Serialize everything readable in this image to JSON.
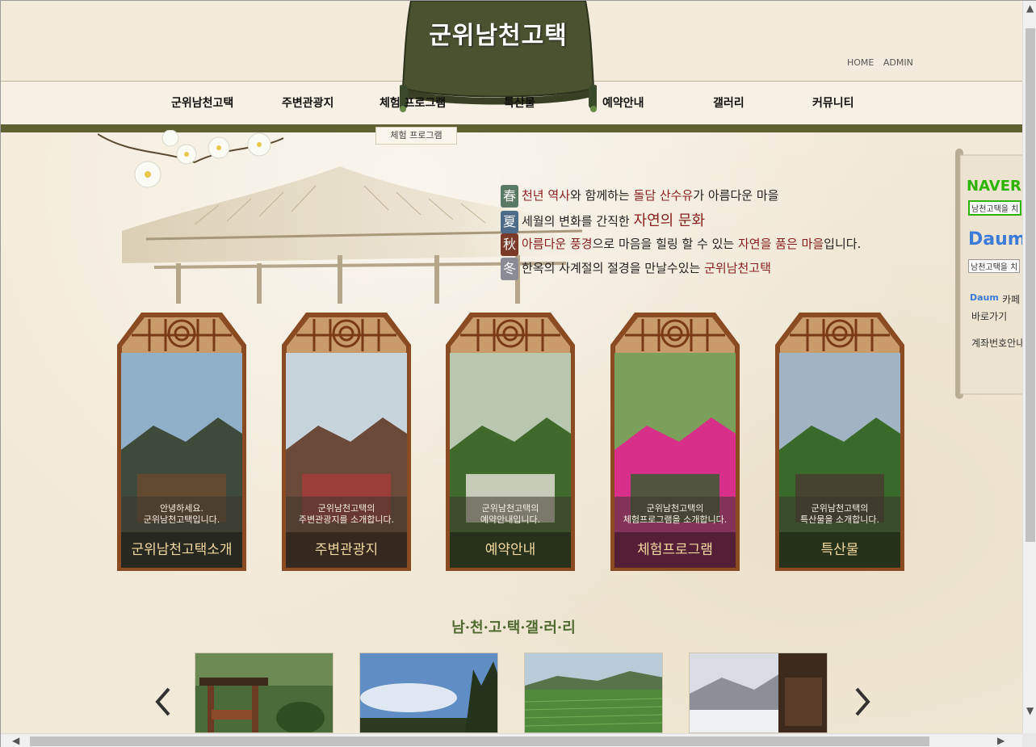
{
  "header": {
    "logo_text": "군위남천고택",
    "top_links": [
      "HOME",
      "ADMIN"
    ]
  },
  "menu": {
    "items": [
      "군위남천고택",
      "주변관광지",
      "체험 프로그램",
      "특산물",
      "예약안내",
      "갤러리",
      "커뮤니티"
    ],
    "submenu_label": "체험 프로그램"
  },
  "seasons": [
    {
      "char": "春",
      "color": "#5b7a64",
      "parts": [
        {
          "t": "천년 역사",
          "h": true
        },
        {
          "t": "와 함께하는 ",
          "h": false
        },
        {
          "t": "돌담 산수유",
          "h": true
        },
        {
          "t": "가 아름다운 마을",
          "h": false
        }
      ]
    },
    {
      "char": "夏",
      "color": "#4f6b8a",
      "parts": [
        {
          "t": "세월의 변화를 간직한 ",
          "h": false
        },
        {
          "t": "자연의 문화",
          "h": true,
          "big": true
        }
      ]
    },
    {
      "char": "秋",
      "color": "#7a3a2a",
      "parts": [
        {
          "t": "아름다운 풍경",
          "h": true
        },
        {
          "t": "으로 마음을 힐링 할 수 있는 ",
          "h": false
        },
        {
          "t": "자연을 품은 마을",
          "h": true
        },
        {
          "t": "입니다.",
          "h": false
        }
      ]
    },
    {
      "char": "冬",
      "color": "#8b8b96",
      "parts": [
        {
          "t": "한옥의 사계절의 절경을 만날수있는 ",
          "h": false
        },
        {
          "t": "군위남천고택",
          "h": true
        }
      ]
    }
  ],
  "cards": [
    {
      "desc1": "안녕하세요.",
      "desc2": "군위남천고택입니다.",
      "title": "군위남천고택소개"
    },
    {
      "desc1": "군위남천고택의",
      "desc2": "주변관광지를 소개합니다.",
      "title": "주변관광지"
    },
    {
      "desc1": "군위남천고택의",
      "desc2": "예약안내입니다.",
      "title": "예약안내"
    },
    {
      "desc1": "군위남천고택의",
      "desc2": "체험프로그램을 소개합니다.",
      "title": "체험프로그램"
    },
    {
      "desc1": "군위남천고택의",
      "desc2": "특산물을 소개합니다.",
      "title": "특산물"
    }
  ],
  "gallery": {
    "title": "남·천·고·택·갤·러·리"
  },
  "sidebar": {
    "naver_logo": "NAVER",
    "naver_search": "남천고택을 치",
    "daum_logo": "Daum",
    "daum_search": "남천고택을 치",
    "cafe_logo": "Daum",
    "cafe_label": "카페",
    "cafe_link": "바로가기",
    "account_label": "계좌번호안내"
  },
  "colors": {
    "nav_line": "#5f6133",
    "highlight": "#8a1d1d",
    "gallery_title": "#4f6a2f",
    "card_title": "#f3d9a0"
  }
}
